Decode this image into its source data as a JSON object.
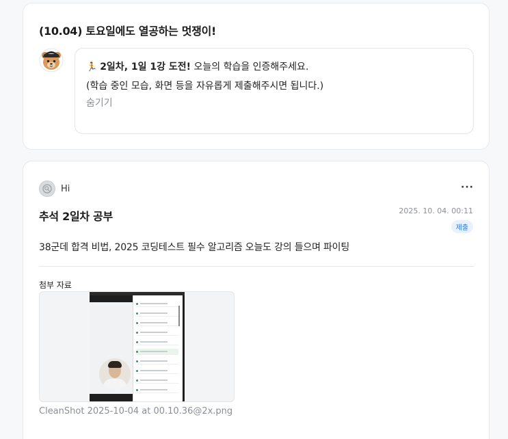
{
  "mission": {
    "title": "(10.04) 토요일에도 열공하는 멋쟁이!",
    "bubble": {
      "emoji": "🏃",
      "bold_text": "2일차, 1일 1강 도전!",
      "text_rest": " 오늘의 학습을 인증해주세요.",
      "line2": "(학습 중인 모습, 화면 등을 자유롭게 제출해주시면 됩니다.)",
      "hide_label": "숨기기"
    },
    "mascot_icon": "bear-mascot-icon"
  },
  "post": {
    "author": "Hi",
    "more_label": "···",
    "title": "추석 2일차 공부",
    "date": "2025. 10. 04. 00:11",
    "status": "제출",
    "body": "38군데 합격 비법, 2025 코딩테스트 필수 알고리즘 오늘도 강의 들으며 파이팅",
    "attachments_label": "첨부 자료",
    "attachment_filename": "CleanShot 2025-10-04 at 00.10.36@2x.png"
  },
  "colors": {
    "badge_text": "#2f7de1",
    "badge_bg": "#e8f1fd",
    "muted": "#8a8f96"
  }
}
